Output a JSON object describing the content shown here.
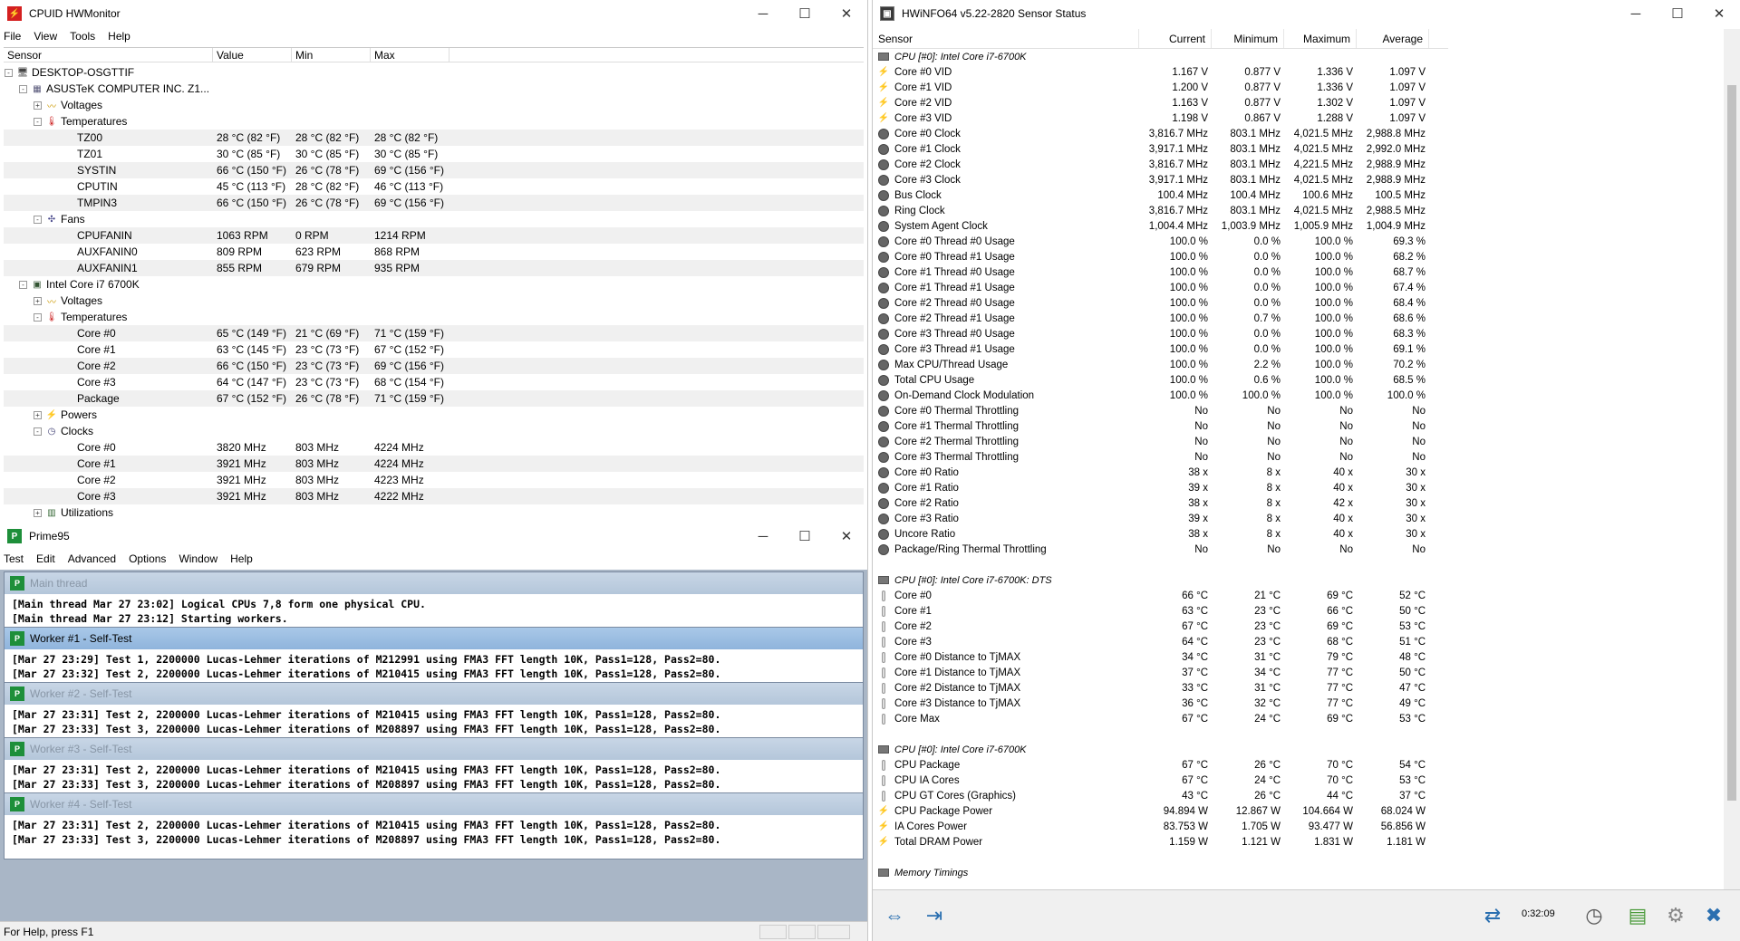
{
  "hwmonitor": {
    "title": "CPUID HWMonitor",
    "menu": [
      "File",
      "View",
      "Tools",
      "Help"
    ],
    "columns": [
      "Sensor",
      "Value",
      "Min",
      "Max"
    ],
    "rows": [
      {
        "label": "DESKTOP-OSGTTIF",
        "depth": 0,
        "exp": "-",
        "icon": "computer-icon"
      },
      {
        "label": "ASUSTeK COMPUTER INC. Z1...",
        "depth": 1,
        "exp": "-",
        "icon": "motherboard-icon"
      },
      {
        "label": "Voltages",
        "depth": 2,
        "exp": "+",
        "icon": "voltage-icon"
      },
      {
        "label": "Temperatures",
        "depth": 2,
        "exp": "-",
        "icon": "thermometer-icon"
      },
      {
        "label": "TZ00",
        "depth": 3,
        "v": "28 °C  (82 °F)",
        "mn": "28 °C  (82 °F)",
        "mx": "28 °C  (82 °F)"
      },
      {
        "label": "TZ01",
        "depth": 3,
        "v": "30 °C  (85 °F)",
        "mn": "30 °C  (85 °F)",
        "mx": "30 °C  (85 °F)"
      },
      {
        "label": "SYSTIN",
        "depth": 3,
        "v": "66 °C  (150 °F)",
        "mn": "26 °C  (78 °F)",
        "mx": "69 °C  (156 °F)"
      },
      {
        "label": "CPUTIN",
        "depth": 3,
        "v": "45 °C  (113 °F)",
        "mn": "28 °C  (82 °F)",
        "mx": "46 °C  (113 °F)"
      },
      {
        "label": "TMPIN3",
        "depth": 3,
        "v": "66 °C  (150 °F)",
        "mn": "26 °C  (78 °F)",
        "mx": "69 °C  (156 °F)"
      },
      {
        "label": "Fans",
        "depth": 2,
        "exp": "-",
        "icon": "fan-icon"
      },
      {
        "label": "CPUFANIN",
        "depth": 3,
        "v": "1063 RPM",
        "mn": "0 RPM",
        "mx": "1214 RPM"
      },
      {
        "label": "AUXFANIN0",
        "depth": 3,
        "v": "809 RPM",
        "mn": "623 RPM",
        "mx": "868 RPM"
      },
      {
        "label": "AUXFANIN1",
        "depth": 3,
        "v": "855 RPM",
        "mn": "679 RPM",
        "mx": "935 RPM"
      },
      {
        "label": "Intel Core i7 6700K",
        "depth": 1,
        "exp": "-",
        "icon": "cpu-icon"
      },
      {
        "label": "Voltages",
        "depth": 2,
        "exp": "+",
        "icon": "voltage-icon"
      },
      {
        "label": "Temperatures",
        "depth": 2,
        "exp": "-",
        "icon": "thermometer-icon"
      },
      {
        "label": "Core #0",
        "depth": 3,
        "v": "65 °C  (149 °F)",
        "mn": "21 °C  (69 °F)",
        "mx": "71 °C  (159 °F)"
      },
      {
        "label": "Core #1",
        "depth": 3,
        "v": "63 °C  (145 °F)",
        "mn": "23 °C  (73 °F)",
        "mx": "67 °C  (152 °F)"
      },
      {
        "label": "Core #2",
        "depth": 3,
        "v": "66 °C  (150 °F)",
        "mn": "23 °C  (73 °F)",
        "mx": "69 °C  (156 °F)"
      },
      {
        "label": "Core #3",
        "depth": 3,
        "v": "64 °C  (147 °F)",
        "mn": "23 °C  (73 °F)",
        "mx": "68 °C  (154 °F)"
      },
      {
        "label": "Package",
        "depth": 3,
        "v": "67 °C  (152 °F)",
        "mn": "26 °C  (78 °F)",
        "mx": "71 °C  (159 °F)"
      },
      {
        "label": "Powers",
        "depth": 2,
        "exp": "+",
        "icon": "power-icon"
      },
      {
        "label": "Clocks",
        "depth": 2,
        "exp": "-",
        "icon": "clock-icon"
      },
      {
        "label": "Core #0",
        "depth": 3,
        "v": "3820 MHz",
        "mn": "803 MHz",
        "mx": "4224 MHz"
      },
      {
        "label": "Core #1",
        "depth": 3,
        "v": "3921 MHz",
        "mn": "803 MHz",
        "mx": "4224 MHz"
      },
      {
        "label": "Core #2",
        "depth": 3,
        "v": "3921 MHz",
        "mn": "803 MHz",
        "mx": "4223 MHz"
      },
      {
        "label": "Core #3",
        "depth": 3,
        "v": "3921 MHz",
        "mn": "803 MHz",
        "mx": "4222 MHz"
      },
      {
        "label": "Utilizations",
        "depth": 2,
        "exp": "+",
        "icon": "utilization-icon"
      }
    ]
  },
  "prime95": {
    "title": "Prime95",
    "menu": [
      "Test",
      "Edit",
      "Advanced",
      "Options",
      "Window",
      "Help"
    ],
    "status": "For Help, press F1",
    "windows": [
      {
        "title": "Main thread",
        "active": false,
        "lines": [
          "[Main thread Mar 27 23:02] Logical CPUs 7,8 form one physical CPU.",
          "[Main thread Mar 27 23:12] Starting workers."
        ]
      },
      {
        "title": "Worker #1 - Self-Test",
        "active": true,
        "lines": [
          "[Mar 27 23:29] Test 1, 2200000 Lucas-Lehmer iterations of M212991 using FMA3 FFT length 10K, Pass1=128, Pass2=80.",
          "[Mar 27 23:32] Test 2, 2200000 Lucas-Lehmer iterations of M210415 using FMA3 FFT length 10K, Pass1=128, Pass2=80."
        ]
      },
      {
        "title": "Worker #2 - Self-Test",
        "active": false,
        "lines": [
          "[Mar 27 23:31] Test 2, 2200000 Lucas-Lehmer iterations of M210415 using FMA3 FFT length 10K, Pass1=128, Pass2=80.",
          "[Mar 27 23:33] Test 3, 2200000 Lucas-Lehmer iterations of M208897 using FMA3 FFT length 10K, Pass1=128, Pass2=80."
        ]
      },
      {
        "title": "Worker #3 - Self-Test",
        "active": false,
        "lines": [
          "[Mar 27 23:31] Test 2, 2200000 Lucas-Lehmer iterations of M210415 using FMA3 FFT length 10K, Pass1=128, Pass2=80.",
          "[Mar 27 23:33] Test 3, 2200000 Lucas-Lehmer iterations of M208897 using FMA3 FFT length 10K, Pass1=128, Pass2=80."
        ]
      },
      {
        "title": "Worker #4 - Self-Test",
        "active": false,
        "lines": [
          "[Mar 27 23:31] Test 2, 2200000 Lucas-Lehmer iterations of M210415 using FMA3 FFT length 10K, Pass1=128, Pass2=80.",
          "[Mar 27 23:33] Test 3, 2200000 Lucas-Lehmer iterations of M208897 using FMA3 FFT length 10K, Pass1=128, Pass2=80."
        ]
      }
    ]
  },
  "hwinfo": {
    "title": "HWiNFO64 v5.22-2820 Sensor Status",
    "columns": [
      "Sensor",
      "Current",
      "Minimum",
      "Maximum",
      "Average"
    ],
    "timer": "0:32:09",
    "rows": [
      {
        "type": "group",
        "name": "CPU [#0]: Intel Core i7-6700K"
      },
      {
        "icon": "volt",
        "name": "Core #0 VID",
        "c": "1.167 V",
        "mn": "0.877 V",
        "mx": "1.336 V",
        "av": "1.097 V"
      },
      {
        "icon": "volt",
        "name": "Core #1 VID",
        "c": "1.200 V",
        "mn": "0.877 V",
        "mx": "1.336 V",
        "av": "1.097 V"
      },
      {
        "icon": "volt",
        "name": "Core #2 VID",
        "c": "1.163 V",
        "mn": "0.877 V",
        "mx": "1.302 V",
        "av": "1.097 V"
      },
      {
        "icon": "volt",
        "name": "Core #3 VID",
        "c": "1.198 V",
        "mn": "0.867 V",
        "mx": "1.288 V",
        "av": "1.097 V"
      },
      {
        "icon": "gauge",
        "name": "Core #0 Clock",
        "c": "3,816.7 MHz",
        "mn": "803.1 MHz",
        "mx": "4,021.5 MHz",
        "av": "2,988.8 MHz"
      },
      {
        "icon": "gauge",
        "name": "Core #1 Clock",
        "c": "3,917.1 MHz",
        "mn": "803.1 MHz",
        "mx": "4,021.5 MHz",
        "av": "2,992.0 MHz"
      },
      {
        "icon": "gauge",
        "name": "Core #2 Clock",
        "c": "3,816.7 MHz",
        "mn": "803.1 MHz",
        "mx": "4,221.5 MHz",
        "av": "2,988.9 MHz"
      },
      {
        "icon": "gauge",
        "name": "Core #3 Clock",
        "c": "3,917.1 MHz",
        "mn": "803.1 MHz",
        "mx": "4,021.5 MHz",
        "av": "2,988.9 MHz"
      },
      {
        "icon": "gauge",
        "name": "Bus Clock",
        "c": "100.4 MHz",
        "mn": "100.4 MHz",
        "mx": "100.6 MHz",
        "av": "100.5 MHz"
      },
      {
        "icon": "gauge",
        "name": "Ring Clock",
        "c": "3,816.7 MHz",
        "mn": "803.1 MHz",
        "mx": "4,021.5 MHz",
        "av": "2,988.5 MHz"
      },
      {
        "icon": "gauge",
        "name": "System Agent Clock",
        "c": "1,004.4 MHz",
        "mn": "1,003.9 MHz",
        "mx": "1,005.9 MHz",
        "av": "1,004.9 MHz"
      },
      {
        "icon": "gauge",
        "name": "Core #0 Thread #0 Usage",
        "c": "100.0 %",
        "mn": "0.0 %",
        "mx": "100.0 %",
        "av": "69.3 %"
      },
      {
        "icon": "gauge",
        "name": "Core #0 Thread #1 Usage",
        "c": "100.0 %",
        "mn": "0.0 %",
        "mx": "100.0 %",
        "av": "68.2 %"
      },
      {
        "icon": "gauge",
        "name": "Core #1 Thread #0 Usage",
        "c": "100.0 %",
        "mn": "0.0 %",
        "mx": "100.0 %",
        "av": "68.7 %"
      },
      {
        "icon": "gauge",
        "name": "Core #1 Thread #1 Usage",
        "c": "100.0 %",
        "mn": "0.0 %",
        "mx": "100.0 %",
        "av": "67.4 %"
      },
      {
        "icon": "gauge",
        "name": "Core #2 Thread #0 Usage",
        "c": "100.0 %",
        "mn": "0.0 %",
        "mx": "100.0 %",
        "av": "68.4 %"
      },
      {
        "icon": "gauge",
        "name": "Core #2 Thread #1 Usage",
        "c": "100.0 %",
        "mn": "0.7 %",
        "mx": "100.0 %",
        "av": "68.6 %"
      },
      {
        "icon": "gauge",
        "name": "Core #3 Thread #0 Usage",
        "c": "100.0 %",
        "mn": "0.0 %",
        "mx": "100.0 %",
        "av": "68.3 %"
      },
      {
        "icon": "gauge",
        "name": "Core #3 Thread #1 Usage",
        "c": "100.0 %",
        "mn": "0.0 %",
        "mx": "100.0 %",
        "av": "69.1 %"
      },
      {
        "icon": "gauge",
        "name": "Max CPU/Thread Usage",
        "c": "100.0 %",
        "mn": "2.2 %",
        "mx": "100.0 %",
        "av": "70.2 %"
      },
      {
        "icon": "gauge",
        "name": "Total CPU Usage",
        "c": "100.0 %",
        "mn": "0.6 %",
        "mx": "100.0 %",
        "av": "68.5 %"
      },
      {
        "icon": "gauge",
        "name": "On-Demand Clock Modulation",
        "c": "100.0 %",
        "mn": "100.0 %",
        "mx": "100.0 %",
        "av": "100.0 %"
      },
      {
        "icon": "gauge",
        "name": "Core #0 Thermal Throttling",
        "c": "No",
        "mn": "No",
        "mx": "No",
        "av": "No"
      },
      {
        "icon": "gauge",
        "name": "Core #1 Thermal Throttling",
        "c": "No",
        "mn": "No",
        "mx": "No",
        "av": "No"
      },
      {
        "icon": "gauge",
        "name": "Core #2 Thermal Throttling",
        "c": "No",
        "mn": "No",
        "mx": "No",
        "av": "No"
      },
      {
        "icon": "gauge",
        "name": "Core #3 Thermal Throttling",
        "c": "No",
        "mn": "No",
        "mx": "No",
        "av": "No"
      },
      {
        "icon": "gauge",
        "name": "Core #0 Ratio",
        "c": "38 x",
        "mn": "8 x",
        "mx": "40 x",
        "av": "30 x"
      },
      {
        "icon": "gauge",
        "name": "Core #1 Ratio",
        "c": "39 x",
        "mn": "8 x",
        "mx": "40 x",
        "av": "30 x"
      },
      {
        "icon": "gauge",
        "name": "Core #2 Ratio",
        "c": "38 x",
        "mn": "8 x",
        "mx": "42 x",
        "av": "30 x"
      },
      {
        "icon": "gauge",
        "name": "Core #3 Ratio",
        "c": "39 x",
        "mn": "8 x",
        "mx": "40 x",
        "av": "30 x"
      },
      {
        "icon": "gauge",
        "name": "Uncore Ratio",
        "c": "38 x",
        "mn": "8 x",
        "mx": "40 x",
        "av": "30 x"
      },
      {
        "icon": "gauge",
        "name": "Package/Ring Thermal Throttling",
        "c": "No",
        "mn": "No",
        "mx": "No",
        "av": "No"
      },
      {
        "type": "blank"
      },
      {
        "type": "group",
        "name": "CPU [#0]: Intel Core i7-6700K: DTS"
      },
      {
        "icon": "therm",
        "name": "Core #0",
        "c": "66 °C",
        "mn": "21 °C",
        "mx": "69 °C",
        "av": "52 °C"
      },
      {
        "icon": "therm",
        "name": "Core #1",
        "c": "63 °C",
        "mn": "23 °C",
        "mx": "66 °C",
        "av": "50 °C"
      },
      {
        "icon": "therm",
        "name": "Core #2",
        "c": "67 °C",
        "mn": "23 °C",
        "mx": "69 °C",
        "av": "53 °C"
      },
      {
        "icon": "therm",
        "name": "Core #3",
        "c": "64 °C",
        "mn": "23 °C",
        "mx": "68 °C",
        "av": "51 °C"
      },
      {
        "icon": "therm",
        "name": "Core #0 Distance to TjMAX",
        "c": "34 °C",
        "mn": "31 °C",
        "mx": "79 °C",
        "av": "48 °C"
      },
      {
        "icon": "therm",
        "name": "Core #1 Distance to TjMAX",
        "c": "37 °C",
        "mn": "34 °C",
        "mx": "77 °C",
        "av": "50 °C"
      },
      {
        "icon": "therm",
        "name": "Core #2 Distance to TjMAX",
        "c": "33 °C",
        "mn": "31 °C",
        "mx": "77 °C",
        "av": "47 °C"
      },
      {
        "icon": "therm",
        "name": "Core #3 Distance to TjMAX",
        "c": "36 °C",
        "mn": "32 °C",
        "mx": "77 °C",
        "av": "49 °C"
      },
      {
        "icon": "therm",
        "name": "Core Max",
        "c": "67 °C",
        "mn": "24 °C",
        "mx": "69 °C",
        "av": "53 °C"
      },
      {
        "type": "blank"
      },
      {
        "type": "group",
        "name": "CPU [#0]: Intel Core i7-6700K"
      },
      {
        "icon": "therm",
        "name": "CPU Package",
        "c": "67 °C",
        "mn": "26 °C",
        "mx": "70 °C",
        "av": "54 °C"
      },
      {
        "icon": "therm",
        "name": "CPU IA Cores",
        "c": "67 °C",
        "mn": "24 °C",
        "mx": "70 °C",
        "av": "53 °C"
      },
      {
        "icon": "therm",
        "name": "CPU GT Cores (Graphics)",
        "c": "43 °C",
        "mn": "26 °C",
        "mx": "44 °C",
        "av": "37 °C"
      },
      {
        "icon": "volt",
        "name": "CPU Package Power",
        "c": "94.894 W",
        "mn": "12.867 W",
        "mx": "104.664 W",
        "av": "68.024 W"
      },
      {
        "icon": "volt",
        "name": "IA Cores Power",
        "c": "83.753 W",
        "mn": "1.705 W",
        "mx": "93.477 W",
        "av": "56.856 W"
      },
      {
        "icon": "volt",
        "name": "Total DRAM Power",
        "c": "1.159 W",
        "mn": "1.121 W",
        "mx": "1.831 W",
        "av": "1.181 W"
      },
      {
        "type": "blank"
      },
      {
        "type": "group",
        "name": "Memory Timings"
      }
    ]
  }
}
